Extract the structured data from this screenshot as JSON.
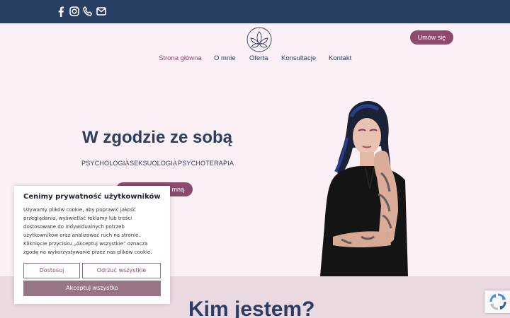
{
  "topbar": {
    "icons": [
      "facebook-icon",
      "instagram-icon",
      "phone-icon",
      "mail-icon"
    ]
  },
  "header": {
    "logo": "lotus-logo",
    "cta_label": "Umów się",
    "nav": [
      "Strona główna",
      "O mnie",
      "Oferta",
      "Konsultacje",
      "Kontakt"
    ],
    "active_nav": "Strona główna"
  },
  "hero": {
    "title": "W zgodzie ze sobą",
    "tags": [
      "PSYCHOLOGIA",
      "SEKSUOLOGIA",
      "PSYCHOTERAPIA"
    ],
    "button_visible_text": "mną"
  },
  "section": {
    "heading": "Kim jestem?"
  },
  "cookie_banner": {
    "title": "Cenimy prywatność użytkowników",
    "lines": [
      "Używamy plików cookie, aby poprawić jakość",
      "przeglądania, wyświetlać reklamy lub treści",
      "dostosowane do indywidualnych potrzeb",
      "użytkowników oraz analizować ruch na stronie.",
      "Kliknięcie przycisku „Akceptuj wszystkie” oznacza",
      "zgodę na wykorzystywanie przez nas plików cookie."
    ],
    "customize_label": "Dostosuj",
    "reject_label": "Odrzuć wszystkie",
    "accept_label": "Akceptuj wszystko"
  },
  "colors": {
    "topbar": "#293e63",
    "page_bg": "#fbf0f5",
    "accent": "#8c4b6e",
    "text": "#2c3d63",
    "band": "#ebd9e2"
  }
}
